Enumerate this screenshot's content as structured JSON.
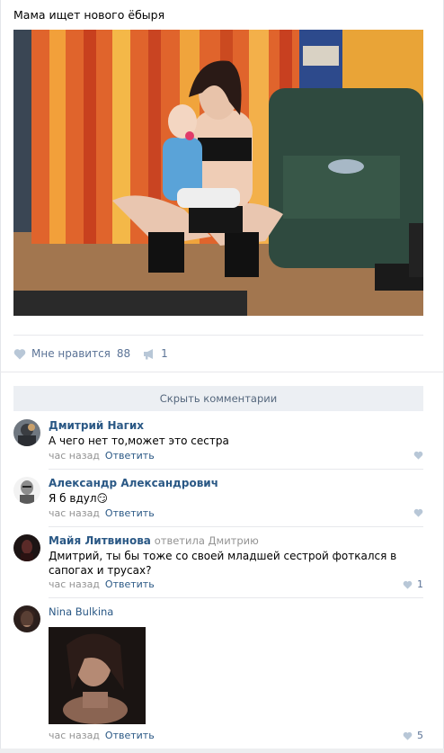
{
  "post": {
    "text": "Мама ищет нового ёбыря",
    "photo_alt": "post-photo"
  },
  "actions": {
    "like_label": "Мне нравится",
    "like_count": "88",
    "share_count": "1"
  },
  "comments_toggle": "Скрыть комментарии",
  "comments": [
    {
      "author": "Дмитрий Нагих",
      "replied_to": "",
      "text": "А чего нет то,может это сестра",
      "time": "час назад",
      "reply_label": "Ответить",
      "likes": ""
    },
    {
      "author": "Александр Александрович",
      "replied_to": "",
      "text": "Я б вдул",
      "emoji": "😏",
      "time": "час назад",
      "reply_label": "Ответить",
      "likes": ""
    },
    {
      "author": "Майя Литвинова",
      "replied_to": "ответила Дмитрию",
      "text": "Дмитрий, ты бы тоже со своей младшей сестрой фоткался в сапогах и трусах?",
      "time": "час назад",
      "reply_label": "Ответить",
      "likes": "1"
    },
    {
      "author": "Nina Bulkina",
      "replied_to": "",
      "text": "",
      "time": "час назад",
      "reply_label": "Ответить",
      "likes": "5"
    }
  ],
  "colors": {
    "link": "#2a5885",
    "muted": "#939393",
    "action": "#5b7396",
    "button_bg": "#eceff3"
  }
}
